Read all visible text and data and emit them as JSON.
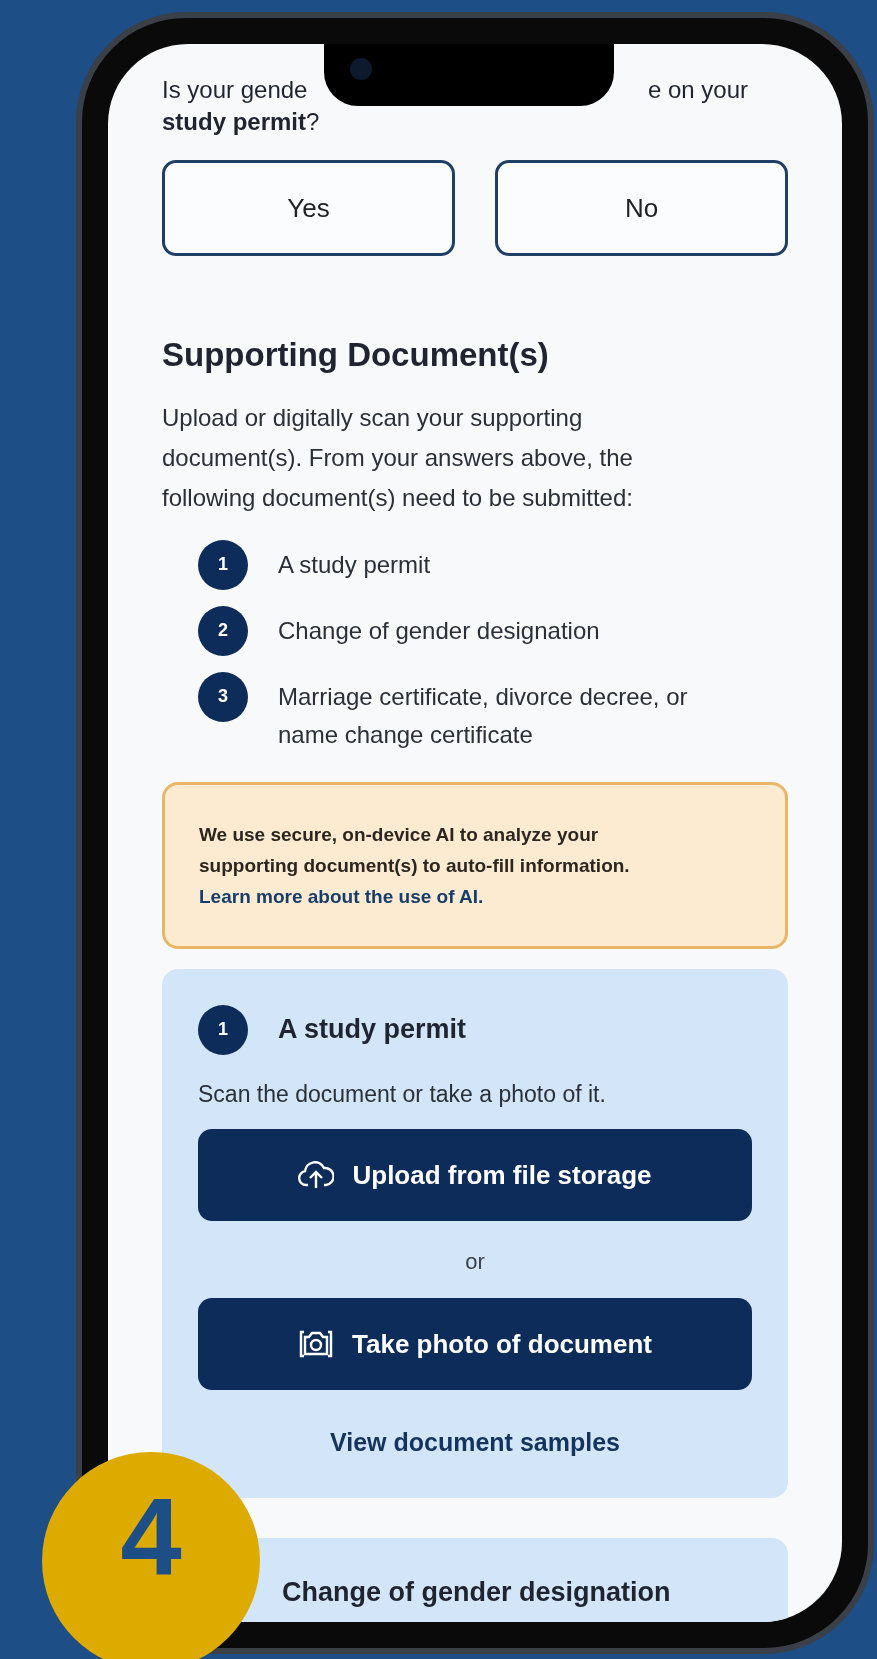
{
  "question": {
    "line_start": "Is your gende",
    "line_end": "e on your",
    "line_2": "**study permit**?"
  },
  "answers": [
    {
      "label": "Yes",
      "selected": false
    },
    {
      "label": "No",
      "selected": false
    }
  ],
  "section": {
    "heading": "Supporting Document(s)",
    "intro": "Upload or digitally scan your supporting document(s). From your answers above, the following document(s) need to be submitted:"
  },
  "required_documents": [
    {
      "number": "1",
      "label": "A study permit"
    },
    {
      "number": "2",
      "label": "Change of gender designation"
    },
    {
      "number": "3",
      "label": "Marriage certificate, divorce decree, or name change certificate"
    }
  ],
  "ai_notice": {
    "text": "We use secure, on-device AI to analyze your supporting document(s) to auto-fill information.",
    "link": "Learn more about the use of AI."
  },
  "upload_card": {
    "number": "1",
    "title": "A study permit",
    "instruction": "Scan the document or take a photo of it.",
    "upload_button": "Upload from file storage",
    "separator": "or",
    "photo_button": "Take photo of document",
    "samples_link": "View document samples"
  },
  "next_card": {
    "title": "Change of gender designation"
  },
  "step_badge": "4"
}
